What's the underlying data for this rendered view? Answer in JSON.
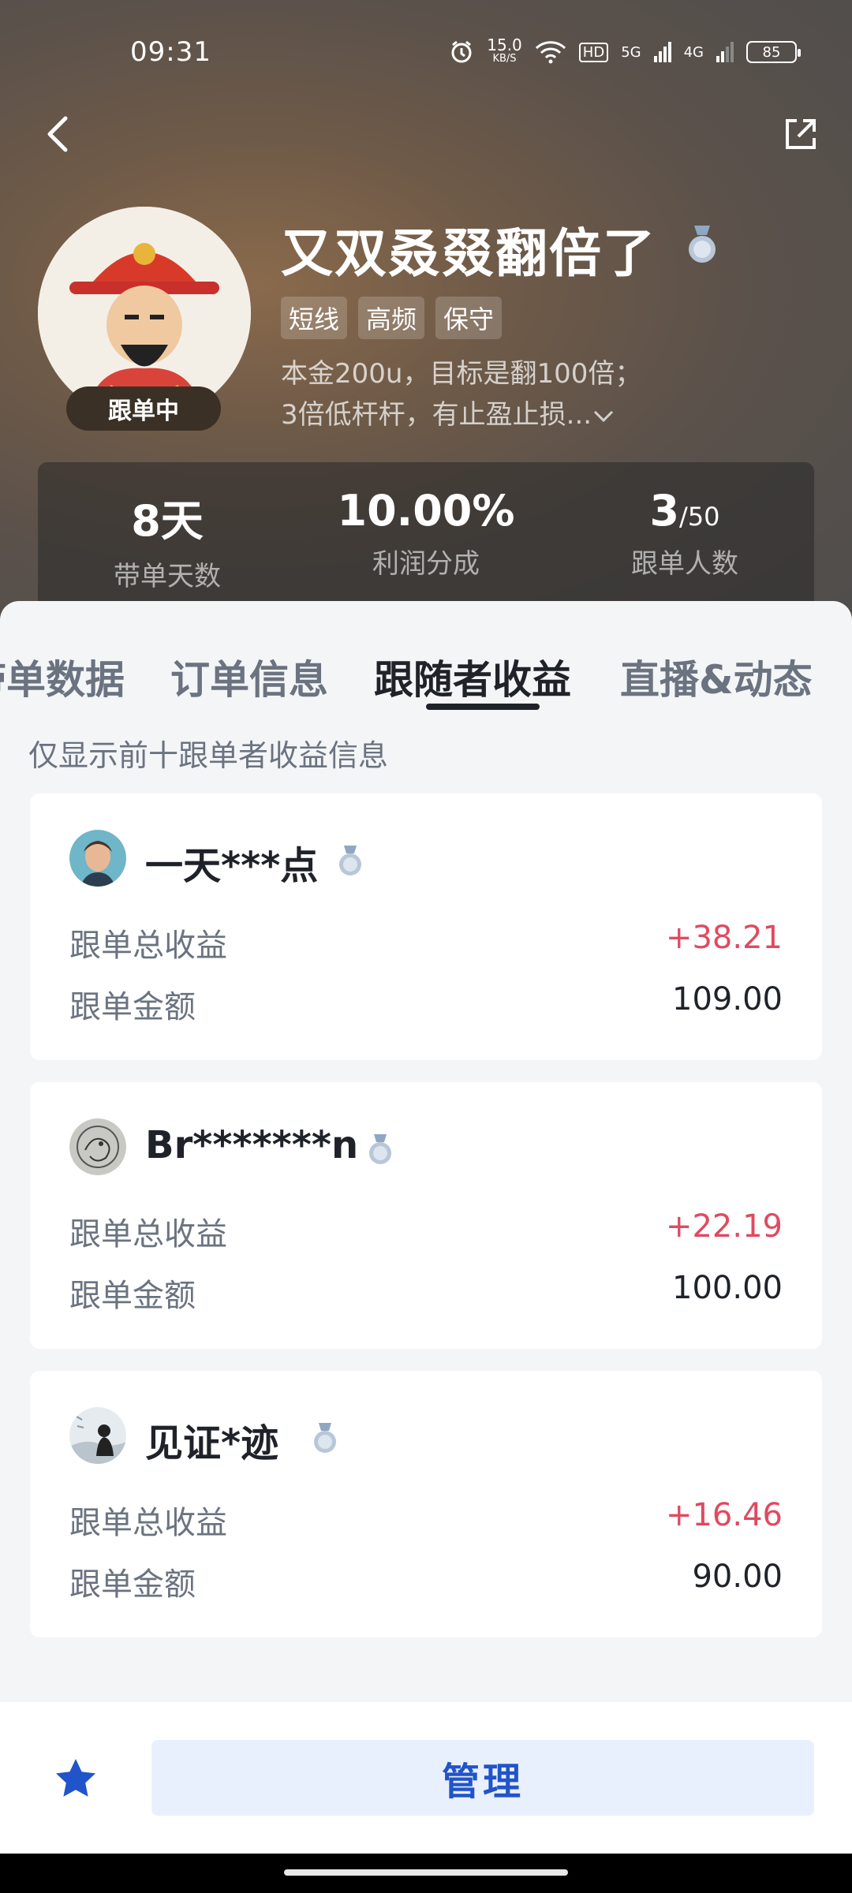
{
  "status_bar": {
    "time": "09:31",
    "net_speed": "15.0",
    "net_unit": "KB/S",
    "hd": "HD",
    "sig1": "5G",
    "sig2": "4G",
    "battery": "85"
  },
  "profile": {
    "name": "又双叒叕翻倍了",
    "following_badge": "跟单中",
    "tags": [
      "短线",
      "高频",
      "保守"
    ],
    "bio_line1": "本金200u，目标是翻100倍；",
    "bio_line2": "3倍低杆杆，有止盈止损..."
  },
  "stats": [
    {
      "value": "8天",
      "suffix": "",
      "label": "带单天数"
    },
    {
      "value": "10.00%",
      "suffix": "",
      "label": "利润分成"
    },
    {
      "value": "3",
      "suffix": "/50",
      "label": "跟单人数"
    }
  ],
  "tabs": [
    {
      "label": "带单数据"
    },
    {
      "label": "订单信息"
    },
    {
      "label": "跟随者收益"
    },
    {
      "label": "直播&动态"
    }
  ],
  "active_tab": "跟随者收益",
  "notice": "仅显示前十跟单者收益信息",
  "followers": [
    {
      "name": "一天***点",
      "profit_label": "跟单总收益",
      "profit": "+38.21",
      "amount_label": "跟单金额",
      "amount": "109.00"
    },
    {
      "name": "Br*******n",
      "profit_label": "跟单总收益",
      "profit": "+22.19",
      "amount_label": "跟单金额",
      "amount": "100.00"
    },
    {
      "name": "见证*迹",
      "profit_label": "跟单总收益",
      "profit": "+16.46",
      "amount_label": "跟单金额",
      "amount": "90.00"
    }
  ],
  "bottom": {
    "manage_label": "管理"
  },
  "colors": {
    "positive": "#e04a5f",
    "accent": "#2154c9",
    "manage_bg": "#e9f0fd"
  }
}
